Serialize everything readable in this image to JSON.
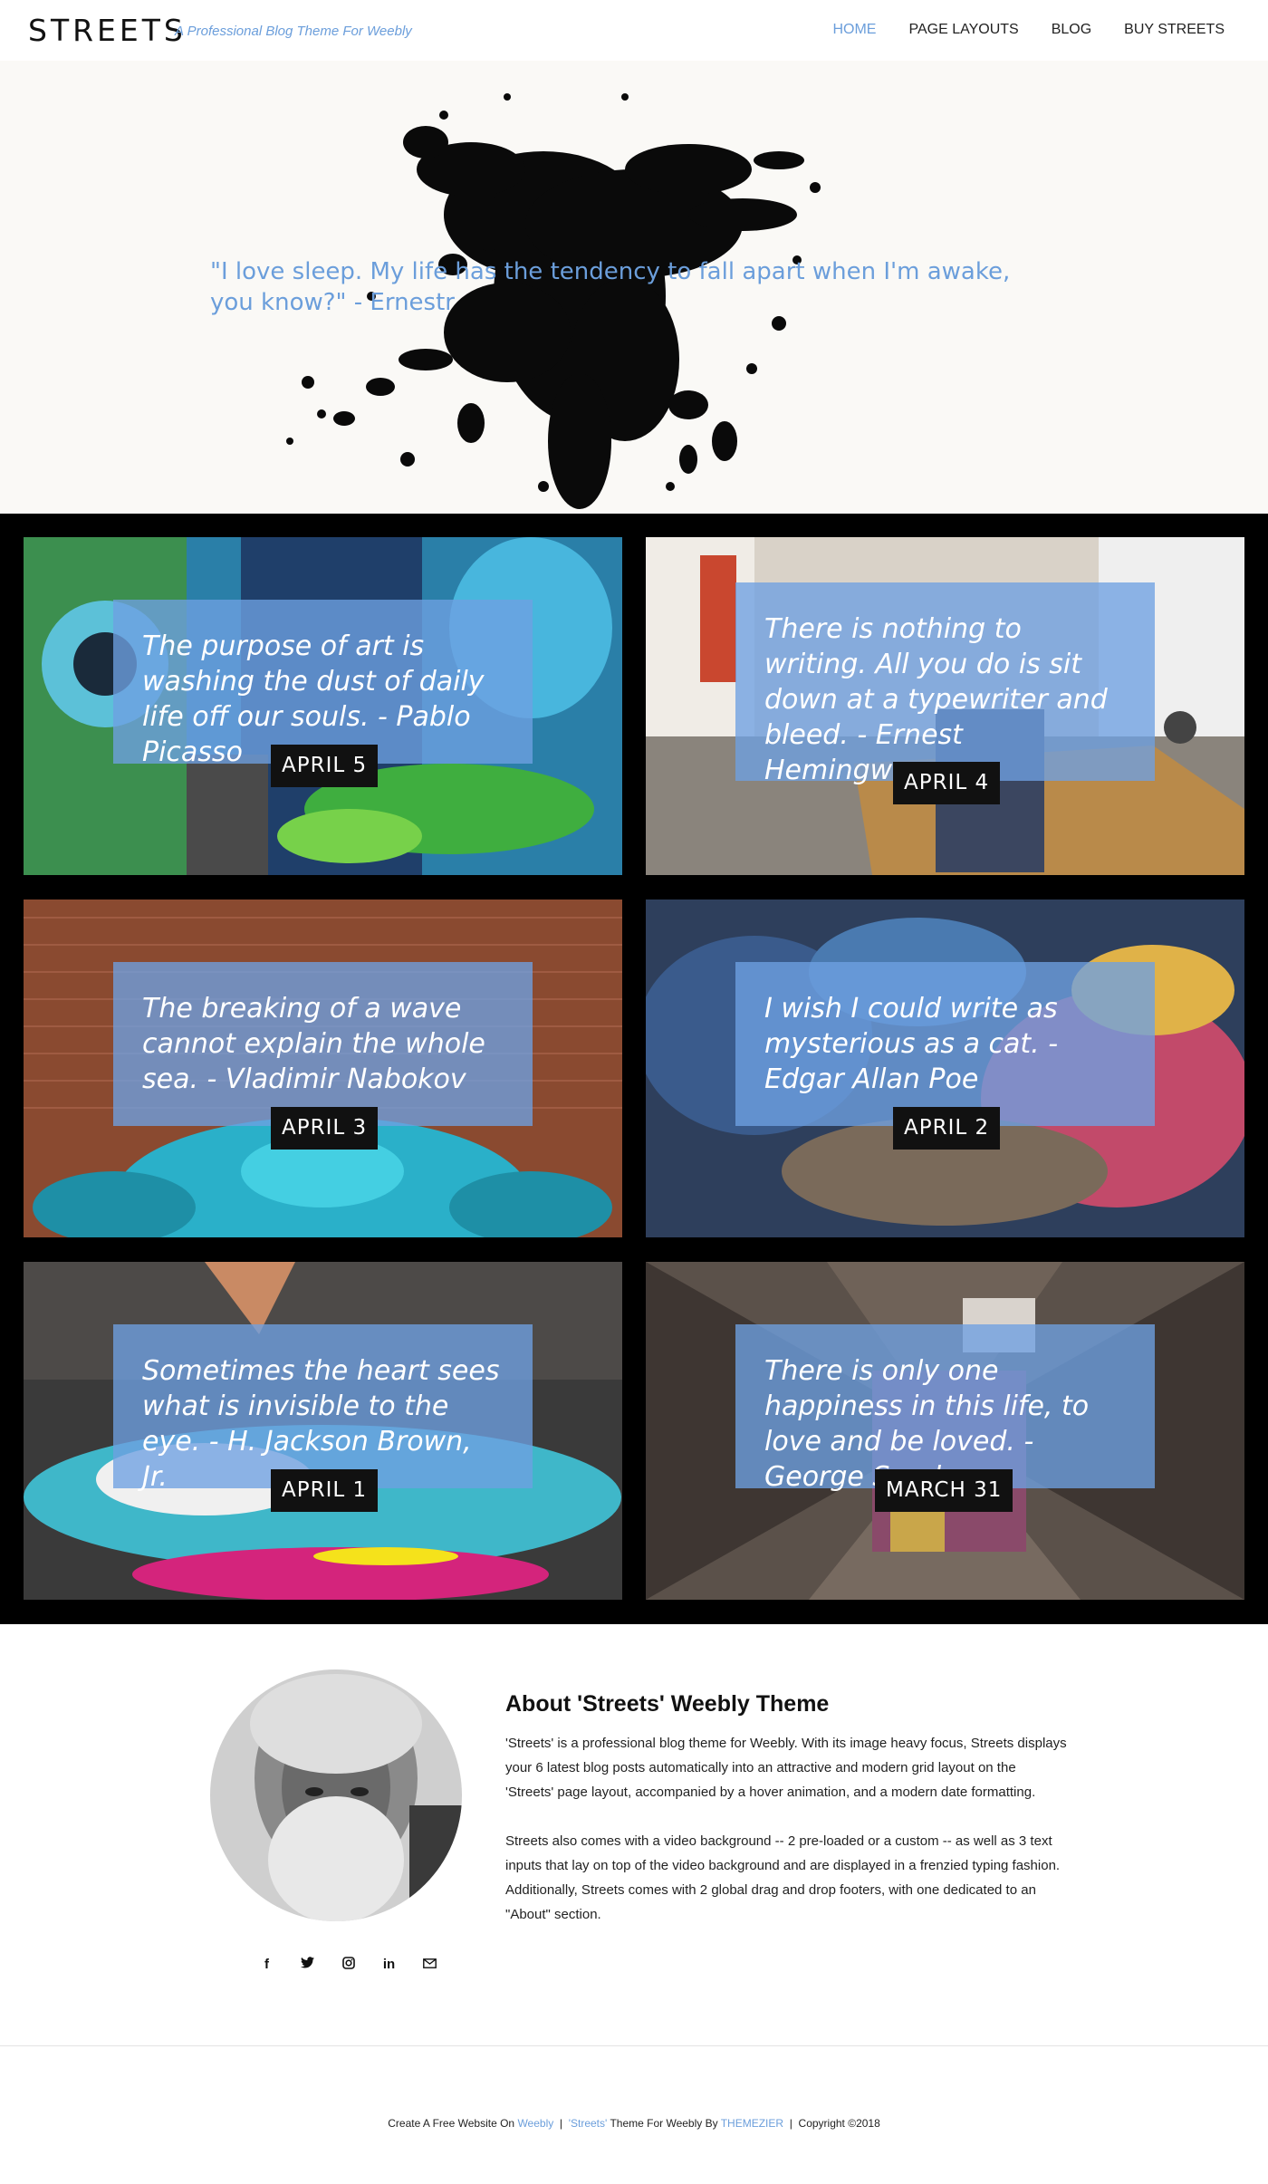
{
  "header": {
    "logo": "STREETS",
    "tagline": "A Professional Blog Theme For Weebly",
    "nav": [
      "HOME",
      "PAGE LAYOUTS",
      "BLOG",
      "BUY STREETS"
    ],
    "active_nav": "HOME"
  },
  "hero": {
    "quote": "\"I love sleep. My life has the tendency to fall apart when I'm awake, you know?\" - Ernestr"
  },
  "posts": [
    {
      "quote": "The purpose of art is washing the dust of daily life off our souls. - Pablo Picasso",
      "date": "APRIL 5"
    },
    {
      "quote": "There is nothing to writing. All you do is sit down at a typewriter and bleed. - Ernest Hemingway",
      "date": "APRIL 4"
    },
    {
      "quote": "The breaking of a wave cannot explain the whole sea. - Vladimir Nabokov",
      "date": "APRIL 3"
    },
    {
      "quote": "I wish I could write as mysterious as a cat. - Edgar Allan Poe",
      "date": "APRIL 2"
    },
    {
      "quote": "Sometimes the heart sees what is invisible to the eye. - H. Jackson Brown, Jr.",
      "date": "APRIL 1"
    },
    {
      "quote": "There is only one happiness in this life, to love and be loved. - George Sand",
      "date": "MARCH 31"
    }
  ],
  "about": {
    "title": "About 'Streets' Weebly Theme",
    "paragraph1": "'Streets' is a professional blog theme for Weebly. With its image heavy focus, Streets displays your 6 latest blog posts automatically into an attractive and modern grid layout on the 'Streets' page layout, accompanied by a hover animation, and a modern date formatting.",
    "paragraph2": "Streets also comes with a video background -- 2 pre-loaded or a custom -- as well as 3 text inputs that lay on top of the video background and are displayed in a frenzied typing fashion. Additionally, Streets comes with 2 global drag and drop footers, with one dedicated to an \"About\" section.",
    "socials": [
      "facebook-icon",
      "twitter-icon",
      "instagram-icon",
      "linkedin-icon",
      "email-icon"
    ]
  },
  "footer": {
    "text1": "Create A Free Website On",
    "link1": "Weebly",
    "sep": "|",
    "link2": "'Streets'",
    "text2": "Theme For Weebly By",
    "link3": "THEMEZIER",
    "text3": "Copyright ©2018"
  },
  "colors": {
    "accent": "#6b9edb",
    "dark": "#000000"
  }
}
